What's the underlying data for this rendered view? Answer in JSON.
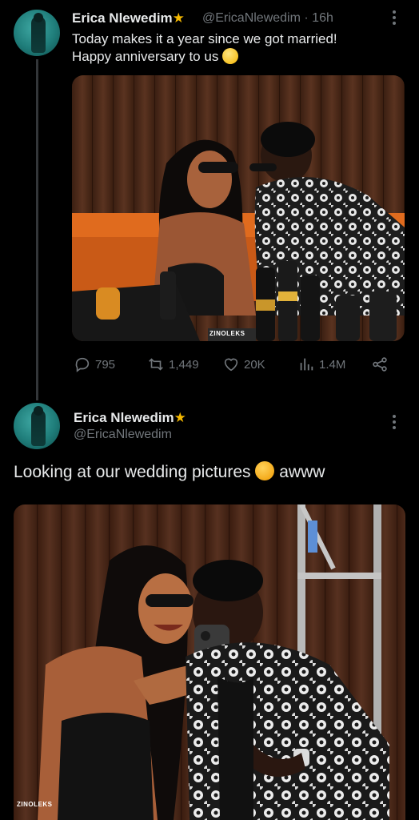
{
  "tweet1": {
    "name": "Erica Nlewedim",
    "verified_icon": "star-icon",
    "handle": "@EricaNlewedim",
    "time": "· 16h",
    "text_line1": "Today makes it a year since we got married!",
    "text_line2": "Happy anniversary to us",
    "photo_watermark": "ZINOLEKS",
    "stats": {
      "replies": "795",
      "reposts": "1,449",
      "likes": "20K",
      "views": "1.4M"
    }
  },
  "tweet2": {
    "name": "Erica Nlewedim",
    "verified_icon": "star-icon",
    "handle": "@EricaNlewedim",
    "text": "Looking at our wedding pictures",
    "text_suffix": "awww",
    "photo_watermark": "ZINOLEKS"
  },
  "colors": {
    "background": "#000000",
    "text": "#e7e9ea",
    "muted": "#71767b",
    "star": "#f5b800"
  }
}
